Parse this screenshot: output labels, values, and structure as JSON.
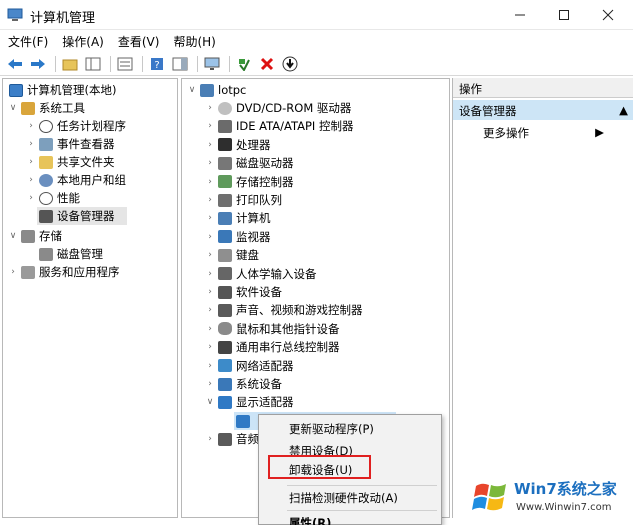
{
  "window": {
    "title": "计算机管理"
  },
  "menu": [
    "文件(F)",
    "操作(A)",
    "查看(V)",
    "帮助(H)"
  ],
  "left_tree": [
    {
      "label": "计算机管理(本地)",
      "icon": "computer-management-icon"
    },
    {
      "label": "系统工具",
      "icon": "tools-icon"
    },
    {
      "label": "任务计划程序",
      "icon": "clock-icon"
    },
    {
      "label": "事件查看器",
      "icon": "event-viewer-icon"
    },
    {
      "label": "共享文件夹",
      "icon": "shared-folder-icon"
    },
    {
      "label": "本地用户和组",
      "icon": "users-icon"
    },
    {
      "label": "性能",
      "icon": "performance-icon"
    },
    {
      "label": "设备管理器",
      "icon": "device-manager-icon"
    },
    {
      "label": "存储",
      "icon": "storage-icon"
    },
    {
      "label": "磁盘管理",
      "icon": "disk-icon"
    },
    {
      "label": "服务和应用程序",
      "icon": "services-icon"
    }
  ],
  "device_tree": {
    "root": "lotpc",
    "items": [
      "DVD/CD-ROM 驱动器",
      "IDE ATA/ATAPI 控制器",
      "处理器",
      "磁盘驱动器",
      "存储控制器",
      "打印队列",
      "计算机",
      "监视器",
      "键盘",
      "人体学输入设备",
      "软件设备",
      "声音、视频和游戏控制器",
      "鼠标和其他指针设备",
      "通用串行总线控制器",
      "网络适配器",
      "系统设备",
      "显示适配器"
    ],
    "partial_item": "音频"
  },
  "actions": {
    "header": "操作",
    "section": "设备管理器",
    "more": "更多操作"
  },
  "context_menu": {
    "items": [
      "更新驱动程序(P)",
      "禁用设备(D)",
      "卸载设备(U)",
      "扫描检测硬件改动(A)",
      "属性(R)"
    ]
  },
  "watermark": {
    "brand": "Win7系统之家",
    "url": "Www.Winwin7.com"
  },
  "colors": {
    "selection": "#cce4f7",
    "highlight_box": "#e02020",
    "brand": "#1c6fbf"
  }
}
